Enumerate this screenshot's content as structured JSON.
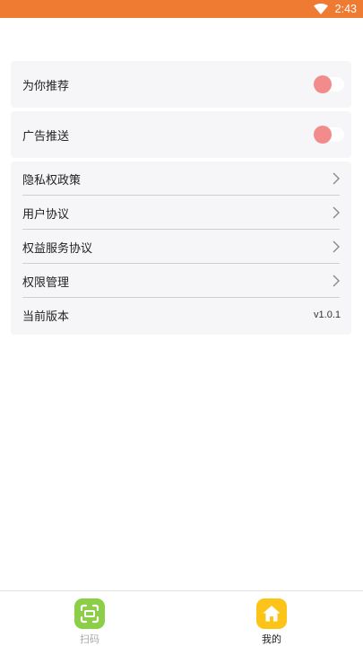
{
  "status_bar": {
    "time": "2:43",
    "icons": [
      "wifi-icon"
    ],
    "color": "#ef7b33"
  },
  "settings": {
    "recommend": {
      "label": "为你推荐",
      "toggle_on": true
    },
    "ads": {
      "label": "广告推送",
      "toggle_on": true
    },
    "list": [
      {
        "label": "隐私权政策",
        "icon": "chevron-right-icon"
      },
      {
        "label": "用户协议",
        "icon": "chevron-right-icon"
      },
      {
        "label": "权益服务协议",
        "icon": "chevron-right-icon"
      },
      {
        "label": "权限管理",
        "icon": "chevron-right-icon"
      }
    ],
    "version": {
      "label": "当前版本",
      "value": "v1.0.1"
    }
  },
  "tab_bar": {
    "tabs": [
      {
        "label": "扫码",
        "icon": "scan-icon",
        "active": false,
        "color": "#8ccf47"
      },
      {
        "label": "我的",
        "icon": "home-icon",
        "active": true,
        "color": "#fcc419"
      }
    ]
  }
}
